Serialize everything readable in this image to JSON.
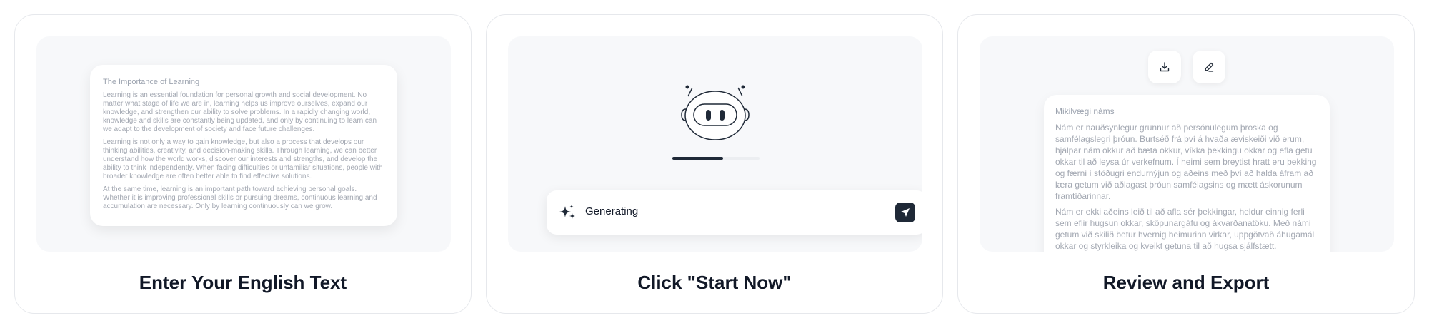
{
  "steps": [
    {
      "title": "Enter Your English Text",
      "document": {
        "heading": "The Importance of Learning",
        "paragraphs": [
          "Learning is an essential foundation for personal growth and social development. No matter what stage of life we are in, learning helps us improve ourselves, expand our knowledge, and strengthen our ability to solve problems. In a rapidly changing world, knowledge and skills are constantly being updated, and only by continuing to learn can we adapt to the development of society and face future challenges.",
          "Learning is not only a way to gain knowledge, but also a process that develops our thinking abilities, creativity, and decision-making skills. Through learning, we can better understand how the world works, discover our interests and strengths, and develop the ability to think independently. When facing difficulties or unfamiliar situations, people with broader knowledge are often better able to find effective solutions.",
          "At the same time, learning is an important path toward achieving personal goals. Whether it is improving professional skills or pursuing dreams, continuous learning and accumulation are necessary. Only by learning continuously can we grow."
        ]
      }
    },
    {
      "title": "Click \"Start Now\"",
      "status_label": "Generating",
      "progress": 0.58,
      "icons": {
        "status": "sparkles-icon",
        "send": "send-icon",
        "robot": "robot-icon"
      }
    },
    {
      "title": "Review and Export",
      "document": {
        "heading": "Mikilvægi náms",
        "paragraphs": [
          "Nám er nauðsynlegur grunnur að persónulegum þroska og samfélagslegri þróun. Burtséð frá því á hvaða æviskeiði við erum, hjálpar nám okkur að bæta okkur, víkka þekkingu okkar og efla getu okkar til að leysa úr verkefnum. Í heimi sem breytist hratt eru þekking og færni í stöðugri endurnýjun og aðeins með því að halda áfram að læra getum við aðlagast þróun samfélagsins og mætt áskorunum framtíðarinnar.",
          "Nám er ekki aðeins leið til að afla sér þekkingar, heldur einnig ferli sem eflir hugsun okkar, sköpunargáfu og ákvarðanatöku. Með námi getum við skilið betur hvernig heimurinn virkar, uppgötvað áhugamál okkar og styrkleika og kveikt getuna til að hugsa sjálfstætt."
        ]
      },
      "icons": {
        "download": "download-icon",
        "edit": "edit-icon"
      }
    }
  ],
  "colors": {
    "accent": "#1f2937",
    "panel": "#f7f8fa",
    "border": "#e6e8ec"
  }
}
